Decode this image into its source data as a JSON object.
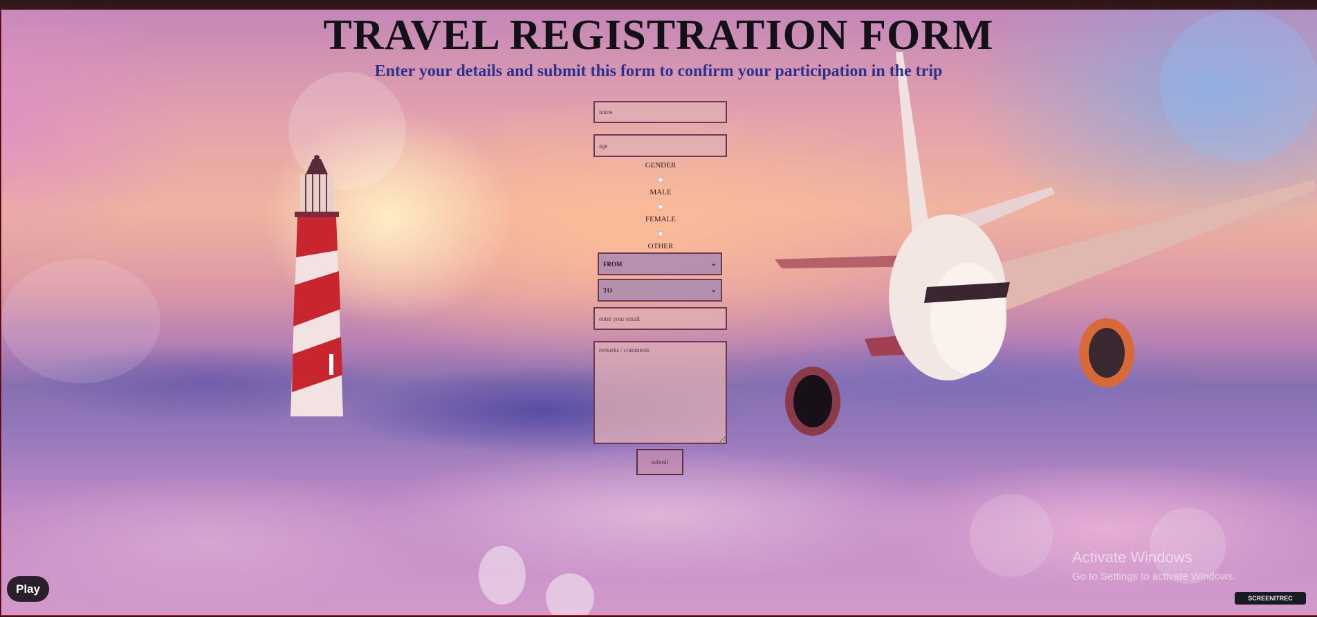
{
  "page": {
    "title": "TRAVEL REGISTRATION FORM",
    "subtitle": "Enter your details and submit this form to confirm your participation in the trip"
  },
  "form": {
    "name_placeholder": "name",
    "age_placeholder": "age",
    "gender_heading": "GENDER",
    "gender_options": [
      "MALE",
      "FEMALE",
      "OTHER"
    ],
    "from_selected": "FROM",
    "to_selected": "TO",
    "email_placeholder": "enter your email",
    "textarea_placeholder": "remarks / comments",
    "submit_label": "submit"
  },
  "overlay": {
    "play_label": "Play",
    "activate_title": "Activate Windows",
    "activate_sub": "Go to Settings to activate Windows.",
    "watermark": "SCREENITREC"
  },
  "colors": {
    "title": "#141018",
    "subtitle": "#2f2f8c",
    "field_border": "#6b3a52",
    "frame_border": "#b01020"
  },
  "icons": {
    "select_chevron": "chevron-down-icon",
    "lighthouse": "lighthouse-illustration",
    "airplane": "airplane-illustration"
  }
}
